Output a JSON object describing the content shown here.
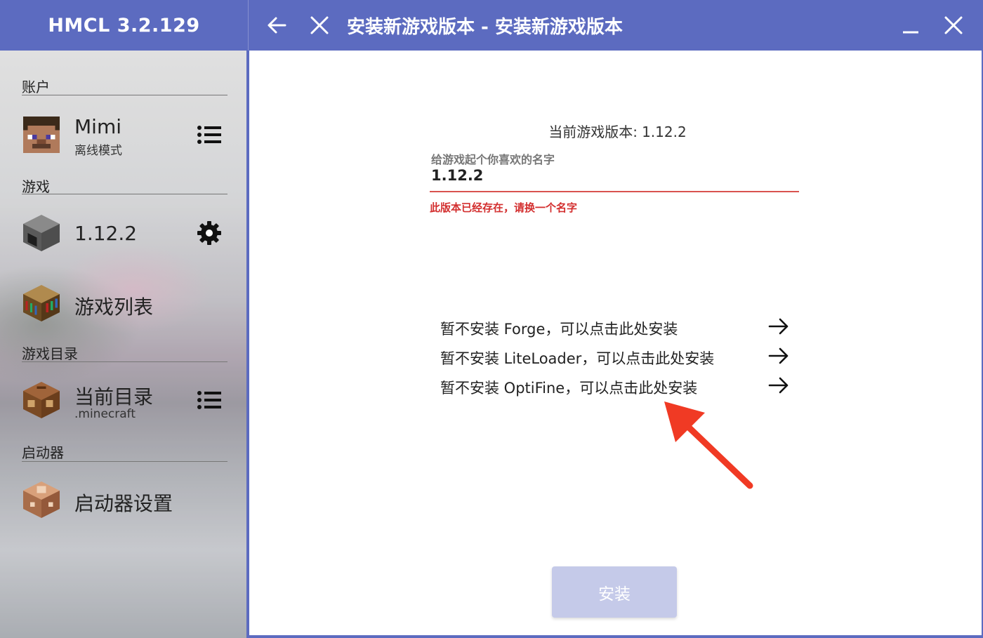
{
  "app": {
    "title": "HMCL 3.2.129"
  },
  "titlebar": {
    "page_title": "安装新游戏版本 - 安装新游戏版本",
    "back_icon": "arrow-left-icon",
    "close_page_icon": "close-icon",
    "minimize_icon": "minimize-icon",
    "window_close_icon": "close-icon"
  },
  "sidebar": {
    "sections": {
      "account": "账户",
      "game": "游戏",
      "game_dir": "游戏目录",
      "launcher": "启动器"
    },
    "account": {
      "name": "Mimi",
      "mode": "离线模式",
      "action_icon": "list-icon"
    },
    "game_version": {
      "name": "1.12.2",
      "action_icon": "gear-icon"
    },
    "game_list": {
      "label": "游戏列表"
    },
    "current_dir": {
      "label": "当前目录",
      "sub": ".minecraft",
      "action_icon": "list-icon"
    },
    "launcher_settings": {
      "label": "启动器设置"
    }
  },
  "main": {
    "current_version_label": "当前游戏版本:",
    "current_version_value": "1.12.2",
    "name_field": {
      "label": "给游戏起个你喜欢的名字",
      "value": "1.12.2",
      "error": "此版本已经存在，请换一个名字"
    },
    "options": [
      {
        "label": "暂不安装 Forge，可以点击此处安装"
      },
      {
        "label": "暂不安装 LiteLoader，可以点击此处安装"
      },
      {
        "label": "暂不安装 OptiFine，可以点击此处安装"
      }
    ],
    "install_button": "安装"
  },
  "colors": {
    "primary": "#5c6bc0",
    "error": "#d32f2f",
    "install_disabled": "#c5cae9",
    "annotation_arrow": "#f03a24"
  }
}
